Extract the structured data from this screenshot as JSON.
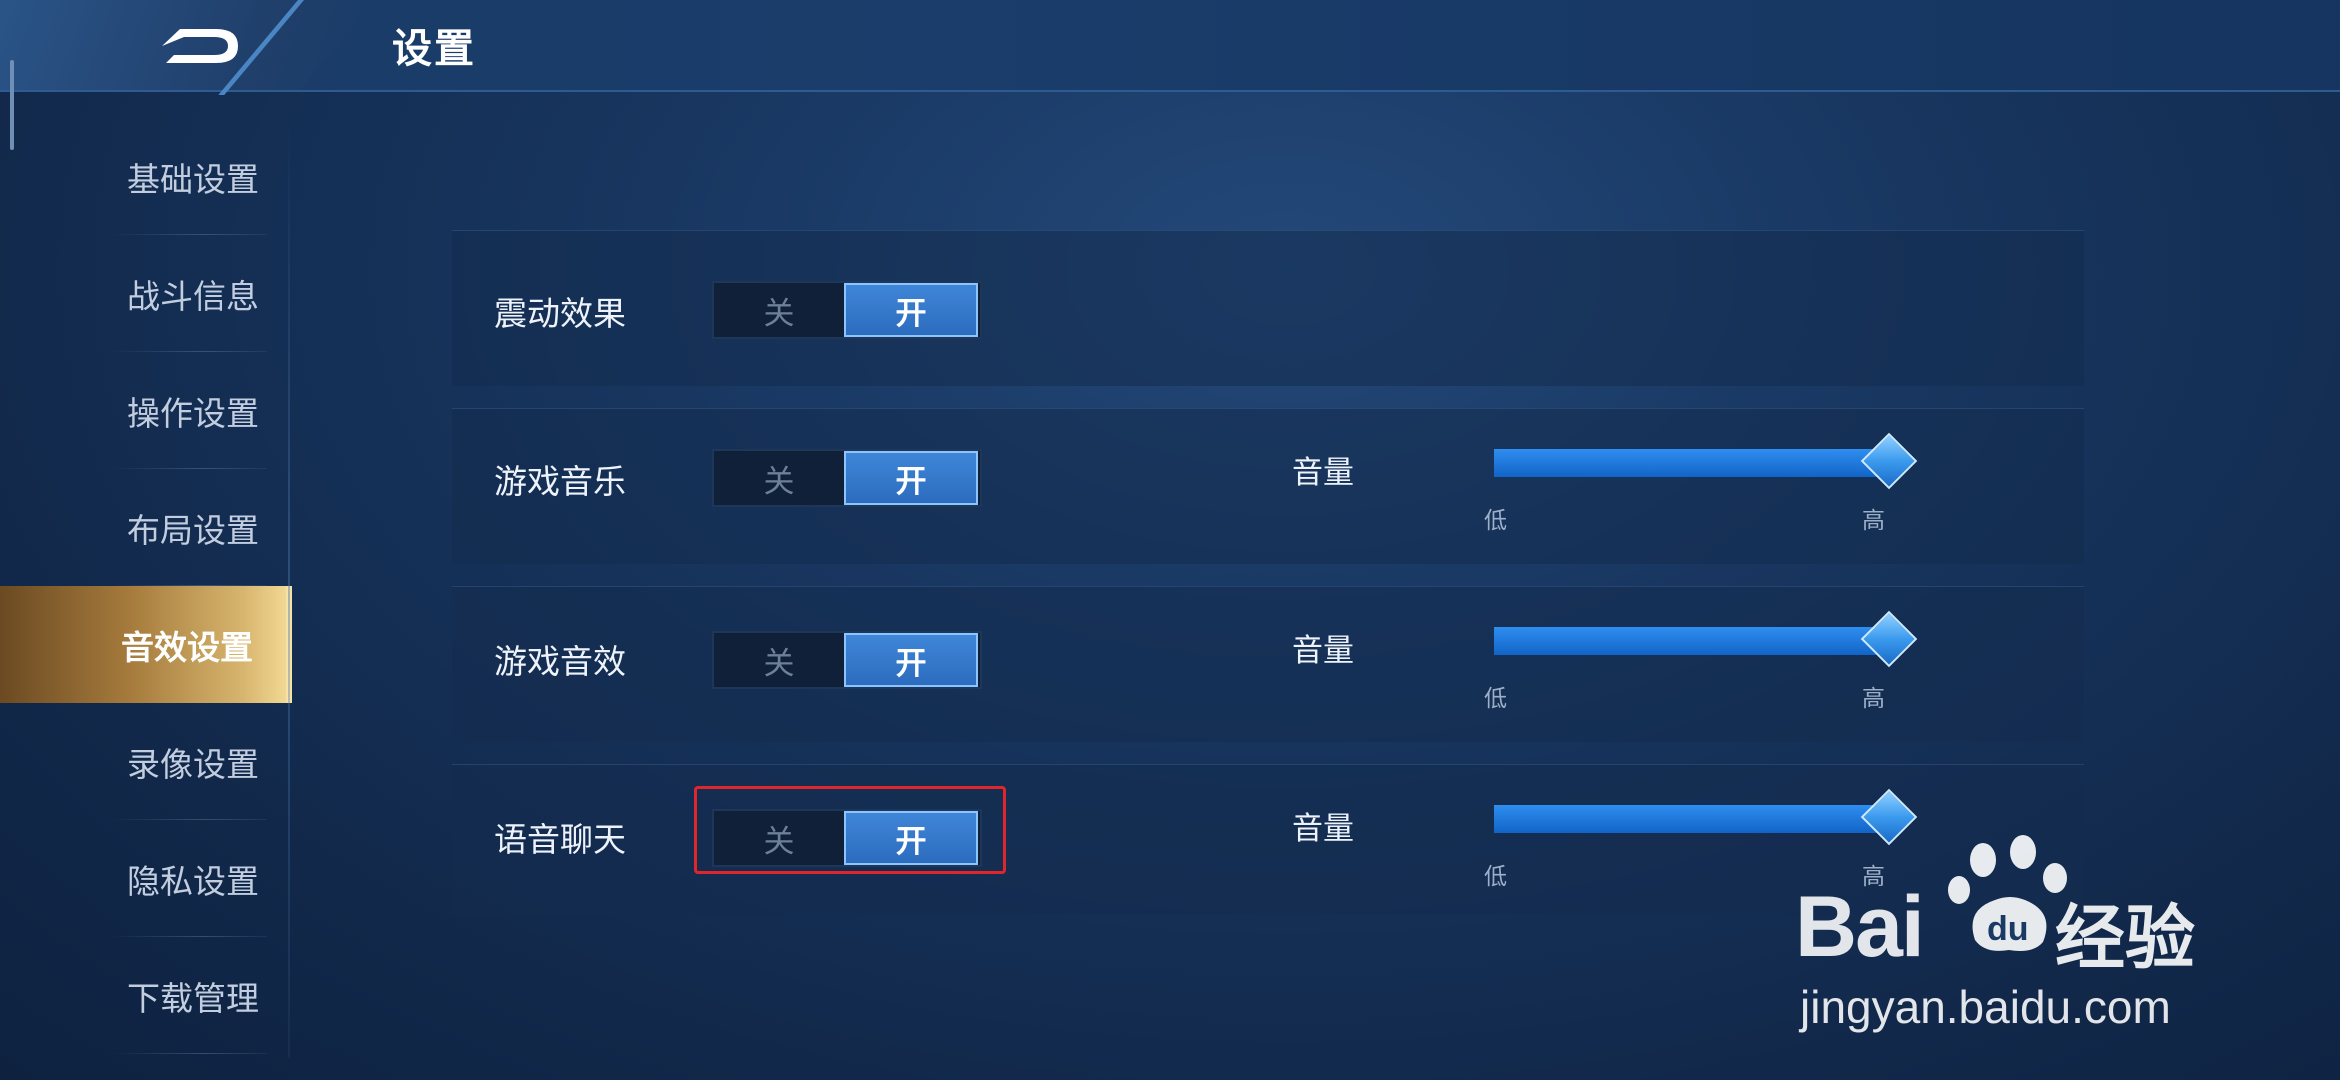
{
  "header": {
    "title": "设置"
  },
  "sidebar": {
    "items": [
      {
        "label": "基础设置",
        "active": false
      },
      {
        "label": "战斗信息",
        "active": false
      },
      {
        "label": "操作设置",
        "active": false
      },
      {
        "label": "布局设置",
        "active": false
      },
      {
        "label": "音效设置",
        "active": true
      },
      {
        "label": "录像设置",
        "active": false
      },
      {
        "label": "隐私设置",
        "active": false
      },
      {
        "label": "下载管理",
        "active": false
      }
    ]
  },
  "settings": {
    "rows": [
      {
        "label": "震动效果",
        "off_label": "关",
        "on_label": "开",
        "state": "on"
      },
      {
        "label": "游戏音乐",
        "off_label": "关",
        "on_label": "开",
        "state": "on",
        "volume": {
          "label": "音量",
          "low": "低",
          "high": "高",
          "level": 1.0
        }
      },
      {
        "label": "游戏音效",
        "off_label": "关",
        "on_label": "开",
        "state": "on",
        "volume": {
          "label": "音量",
          "low": "低",
          "high": "高",
          "level": 1.0
        }
      },
      {
        "label": "语音聊天",
        "off_label": "关",
        "on_label": "开",
        "state": "on",
        "volume": {
          "label": "音量",
          "low": "低",
          "high": "高",
          "level": 1.0
        }
      }
    ]
  },
  "highlight": {
    "color": "#e0262b"
  },
  "watermark": {
    "brand": "Bai",
    "brand_suffix": "经验",
    "url": "jingyan.baidu.com"
  },
  "colors": {
    "accent": "#2f8ef0",
    "active_tab": "#d7b56e"
  }
}
